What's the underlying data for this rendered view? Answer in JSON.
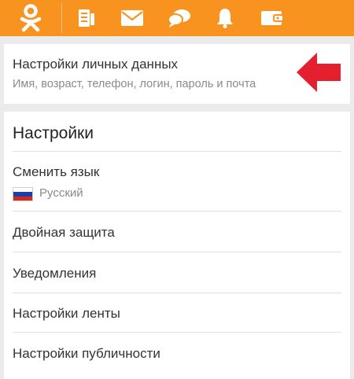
{
  "header": {
    "brand": "Odnoklassniki",
    "icons": [
      "ok-logo-icon",
      "feed-icon",
      "messages-icon",
      "discussions-icon",
      "notifications-icon",
      "wallet-icon"
    ],
    "accent_color": "#f7931e"
  },
  "personal_data": {
    "title": "Настройки личных данных",
    "subtitle": "Имя, возраст, телефон, логин, пароль и почта",
    "arrow_color": "#e5202e"
  },
  "settings": {
    "title": "Настройки",
    "items": [
      {
        "label": "Сменить язык",
        "value": "Русский"
      },
      {
        "label": "Двойная защита"
      },
      {
        "label": "Уведомления"
      },
      {
        "label": "Настройки ленты"
      },
      {
        "label": "Настройки публичности"
      }
    ]
  }
}
